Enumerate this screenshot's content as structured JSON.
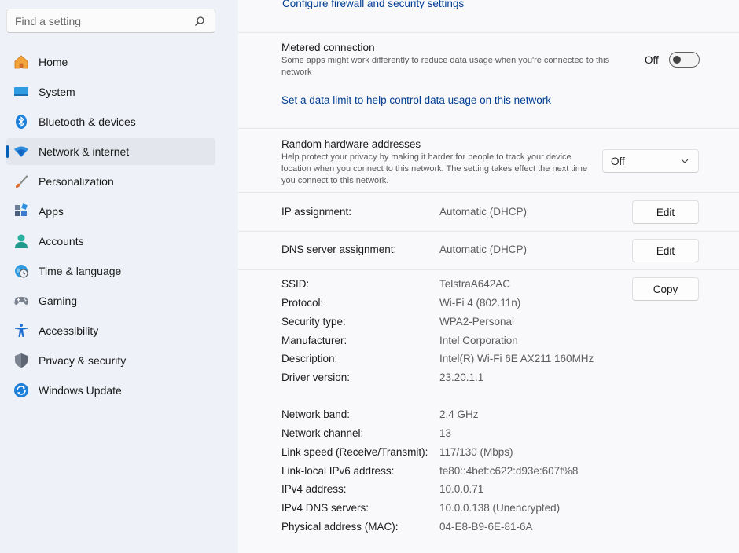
{
  "search": {
    "placeholder": "Find a setting"
  },
  "nav": [
    {
      "label": "Home",
      "icon": "home-icon"
    },
    {
      "label": "System",
      "icon": "system-icon"
    },
    {
      "label": "Bluetooth & devices",
      "icon": "bluetooth-icon"
    },
    {
      "label": "Network & internet",
      "icon": "wifi-icon",
      "active": true
    },
    {
      "label": "Personalization",
      "icon": "brush-icon"
    },
    {
      "label": "Apps",
      "icon": "apps-icon"
    },
    {
      "label": "Accounts",
      "icon": "accounts-icon"
    },
    {
      "label": "Time & language",
      "icon": "globe-clock-icon"
    },
    {
      "label": "Gaming",
      "icon": "gamepad-icon"
    },
    {
      "label": "Accessibility",
      "icon": "accessibility-icon"
    },
    {
      "label": "Privacy & security",
      "icon": "shield-icon"
    },
    {
      "label": "Windows Update",
      "icon": "update-icon"
    }
  ],
  "firewall_link": "Configure firewall and security settings",
  "metered": {
    "title": "Metered connection",
    "description": "Some apps might work differently to reduce data usage when you're connected to this network",
    "state_label": "Off",
    "on": false,
    "data_limit_link": "Set a data limit to help control data usage on this network"
  },
  "random_hw": {
    "title": "Random hardware addresses",
    "description": "Help protect your privacy by making it harder for people to track your device location when you connect to this network. The setting takes effect the next time you connect to this network.",
    "selected": "Off"
  },
  "ip_assignment": {
    "label": "IP assignment:",
    "value": "Automatic (DHCP)",
    "button": "Edit"
  },
  "dns_assignment": {
    "label": "DNS server assignment:",
    "value": "Automatic (DHCP)",
    "button": "Edit"
  },
  "properties": {
    "copy_button": "Copy",
    "group1": [
      {
        "label": "SSID:",
        "value": "TelstraA642AC"
      },
      {
        "label": "Protocol:",
        "value": "Wi-Fi 4 (802.11n)"
      },
      {
        "label": "Security type:",
        "value": "WPA2-Personal"
      },
      {
        "label": "Manufacturer:",
        "value": "Intel Corporation"
      },
      {
        "label": "Description:",
        "value": "Intel(R) Wi-Fi 6E AX211 160MHz"
      },
      {
        "label": "Driver version:",
        "value": "23.20.1.1"
      }
    ],
    "group2": [
      {
        "label": "Network band:",
        "value": "2.4 GHz"
      },
      {
        "label": "Network channel:",
        "value": "13"
      },
      {
        "label": "Link speed (Receive/Transmit):",
        "value": "117/130 (Mbps)"
      },
      {
        "label": "Link-local IPv6 address:",
        "value": "fe80::4bef:c622:d93e:607f%8"
      },
      {
        "label": "IPv4 address:",
        "value": "10.0.0.71"
      },
      {
        "label": "IPv4 DNS servers:",
        "value": "10.0.0.138 (Unencrypted)"
      },
      {
        "label": "Physical address (MAC):",
        "value": "04-E8-B9-6E-81-6A"
      }
    ]
  },
  "colors": {
    "accent": "#005fb8",
    "link": "#003e92"
  }
}
